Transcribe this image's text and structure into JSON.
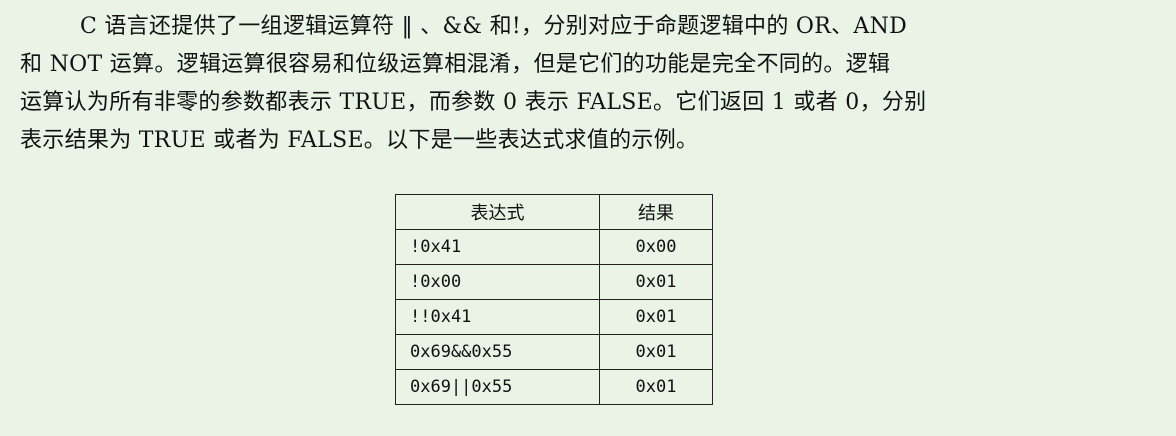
{
  "paragraph": {
    "lines": [
      "C 语言还提供了一组逻辑运算符 ‖ 、&& 和!，分别对应于命题逻辑中的 OR、AND",
      "和 NOT 运算。逻辑运算很容易和位级运算相混淆，但是它们的功能是完全不同的。逻辑",
      "运算认为所有非零的参数都表示 TRUE，而参数 0 表示 FALSE。它们返回 1 或者 0，分别",
      "表示结果为 TRUE 或者为 FALSE。以下是一些表达式求值的示例。"
    ]
  },
  "table": {
    "headers": [
      "表达式",
      "结果"
    ],
    "rows": [
      {
        "expr": "!0x41",
        "result": "0x00"
      },
      {
        "expr": "!0x00",
        "result": "0x01"
      },
      {
        "expr": "!!0x41",
        "result": "0x01"
      },
      {
        "expr": "0x69&&0x55",
        "result": "0x01"
      },
      {
        "expr": "0x69||0x55",
        "result": "0x01"
      }
    ]
  }
}
